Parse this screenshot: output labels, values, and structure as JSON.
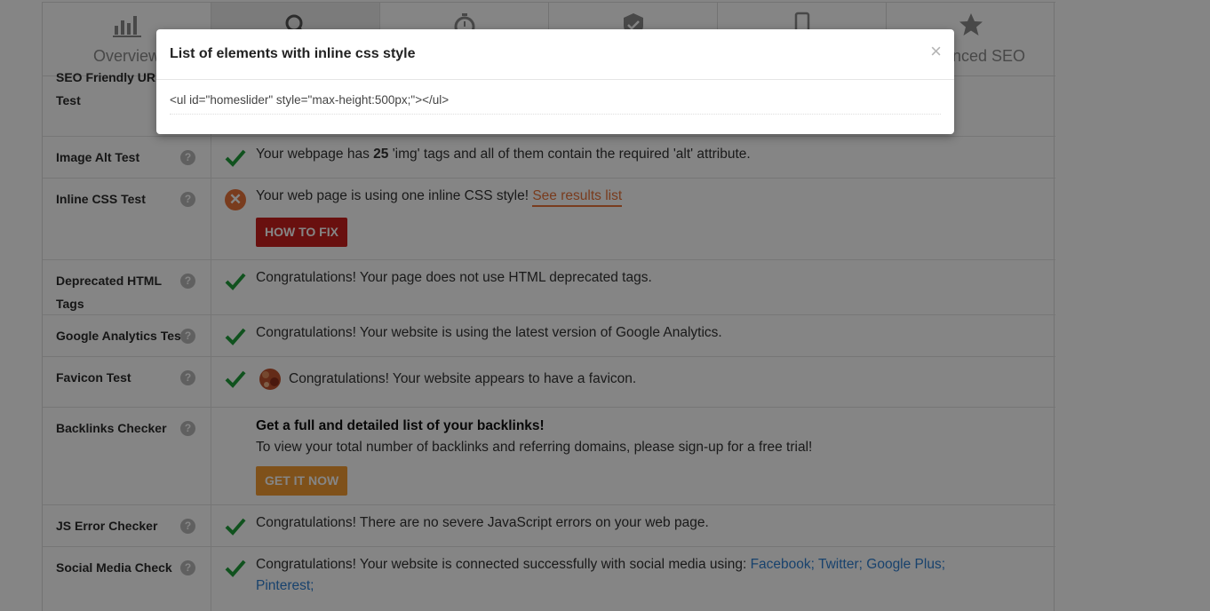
{
  "tabs": [
    {
      "label": "Overview",
      "icon": "bar-chart-icon"
    },
    {
      "label": "",
      "icon": "search-icon"
    },
    {
      "label": "",
      "icon": "stopwatch-icon"
    },
    {
      "label": "",
      "icon": "shield-check-icon"
    },
    {
      "label": "",
      "icon": "mobile-icon"
    },
    {
      "label": "nced SEO",
      "icon": "star-icon"
    }
  ],
  "rows": {
    "seo_url": {
      "label_line1": "SEO Friendly URL",
      "label_line2": "Test"
    },
    "image_alt": {
      "label": "Image Alt Test",
      "text_before": "Your webpage has ",
      "count": "25",
      "text_after": " 'img' tags and all of them contain the required 'alt' attribute."
    },
    "inline_css": {
      "label": "Inline CSS Test",
      "text": "Your web page is using one inline CSS style! ",
      "link": "See results list",
      "button": "HOW TO FIX"
    },
    "deprecated": {
      "label_line1": "Deprecated HTML",
      "label_line2": "Tags",
      "text": "Congratulations! Your page does not use HTML deprecated tags."
    },
    "analytics": {
      "label": "Google Analytics Test",
      "text": "Congratulations! Your website is using the latest version of Google Analytics."
    },
    "favicon": {
      "label": "Favicon Test",
      "text": "Congratulations! Your website appears to have a favicon."
    },
    "backlinks": {
      "label": "Backlinks Checker",
      "heading": "Get a full and detailed list of your backlinks!",
      "text": "To view your total number of backlinks and referring domains, please sign-up for a free trial!",
      "button": "GET IT NOW"
    },
    "js_error": {
      "label": "JS Error Checker",
      "text": "Congratulations! There are no severe JavaScript errors on your web page."
    },
    "social": {
      "label": "Social Media Check",
      "text": "Congratulations! Your website is connected successfully with social media using: ",
      "links": [
        "Facebook;",
        "Twitter;",
        "Google Plus;",
        "Pinterest;"
      ]
    }
  },
  "help_glyph": "?",
  "modal": {
    "title": "List of elements with inline css style",
    "close": "×",
    "code": "<ul id=\"homeslider\" style=\"max-height:500px;\"></ul>"
  },
  "colors": {
    "check": "#1f9d3a",
    "cross": "#e8733a",
    "red_button": "#c9201d",
    "orange_button": "#f39c33",
    "link": "#2f7fd1"
  }
}
